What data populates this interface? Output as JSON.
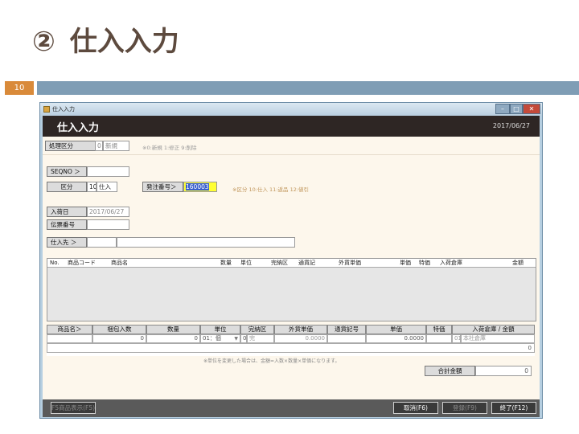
{
  "slide": {
    "title_num": "②",
    "title": "仕入入力",
    "page_number": "10"
  },
  "window": {
    "title": "仕入入力",
    "icons": {
      "app": "app-icon",
      "minimize": "minimize-icon",
      "maximize": "maximize-icon",
      "close": "close-icon"
    },
    "minimize_label": "–",
    "maximize_label": "□",
    "close_label": "✕"
  },
  "header": {
    "title": "仕入入力",
    "date": "2017/06/27"
  },
  "form": {
    "process_label": "処理区分",
    "process_value": "0",
    "process_name": "新規",
    "process_hint": "※0:新規 1:修正 9:削除",
    "seqno_label": "SEQNO ＞",
    "seqno_value": "",
    "kubun_label": "区分",
    "kubun_value": "10",
    "kubun_name": "仕入",
    "order_label": "発注番号＞",
    "order_value": "160003",
    "kubun_hint": "※区分 10:仕入 11:返品 12:値引",
    "arrival_label": "入荷日",
    "arrival_value": "2017/06/27",
    "slip_label": "伝票番号",
    "slip_value": "",
    "supplier_label": "仕入先 ＞",
    "supplier_code": "",
    "supplier_name": ""
  },
  "grid": {
    "columns": [
      "No.",
      "商品コード",
      "商品名",
      "数量",
      "単位",
      "完納区",
      "通貨記",
      "外貨単価",
      "単価",
      "特価",
      "入荷倉庫",
      "金額"
    ]
  },
  "detail": {
    "headers": [
      "商品名＞",
      "梱包入数",
      "数量",
      "単位",
      "完納区",
      "外貨単価",
      "通貨記号",
      "単価",
      "特価",
      "入荷倉庫 / 金額"
    ],
    "product": "",
    "pack_qty": "0",
    "qty": "0",
    "unit": "01：個",
    "kanno_code": "0",
    "kanno_name": "完",
    "foreign_price": "0.0000",
    "currency": "",
    "price": "0.0000",
    "special": "",
    "warehouse_code": "01",
    "warehouse_name": "本社倉庫",
    "amount": "0"
  },
  "note": "※単位を変更した場合は、金額=入数×数量×単価になります。",
  "total": {
    "label": "合計金額",
    "value": "0"
  },
  "footer": {
    "btn_left": "F5商品表示(F5)",
    "btn_cancel": "取消(F6)",
    "btn_register": "登録(F9)",
    "btn_exit": "終了(F12)"
  }
}
